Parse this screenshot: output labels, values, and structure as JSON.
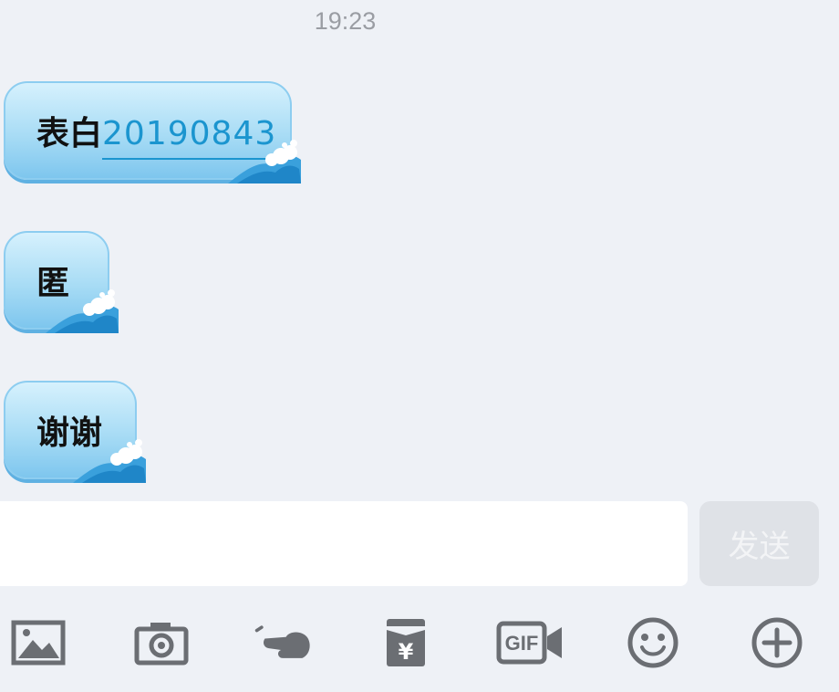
{
  "status": {
    "time": "19:23"
  },
  "messages": [
    {
      "prefix": "表白",
      "link": "20190843"
    },
    {
      "text": "匿"
    },
    {
      "text": "谢谢"
    }
  ],
  "composer": {
    "input_value": "",
    "send_label": "发送"
  },
  "toolbar": {
    "icons": [
      "image-icon",
      "camera-icon",
      "poke-icon",
      "red-packet-icon",
      "gif-icon",
      "emoji-icon",
      "plus-icon"
    ],
    "red_packet_symbol": "¥",
    "gif_label": "GIF"
  },
  "colors": {
    "background": "#eef1f6",
    "bubble_top": "#d6f1fd",
    "bubble_bottom": "#7ec6ee",
    "link": "#1b95cf",
    "icon": "#6b6e73"
  }
}
